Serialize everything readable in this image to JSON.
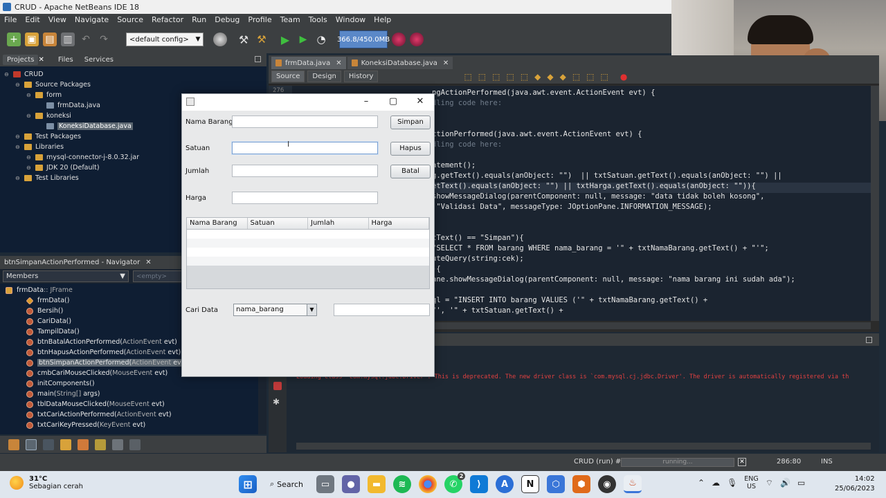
{
  "window": {
    "title": "CRUD - Apache NetBeans IDE 18"
  },
  "menubar": [
    "File",
    "Edit",
    "View",
    "Navigate",
    "Source",
    "Refactor",
    "Run",
    "Debug",
    "Profile",
    "Team",
    "Tools",
    "Window",
    "Help"
  ],
  "toolbar": {
    "config": "<default config>",
    "memory": "366.8/450.0MB"
  },
  "projects_panel": {
    "tabs": [
      "Projects",
      "Files",
      "Services"
    ],
    "tree": [
      {
        "label": "CRUD",
        "level": 0
      },
      {
        "label": "Source Packages",
        "level": 1
      },
      {
        "label": "form",
        "level": 2
      },
      {
        "label": "frmData.java",
        "level": 3
      },
      {
        "label": "koneksi",
        "level": 2
      },
      {
        "label": "KoneksiDatabase.java",
        "level": 3,
        "selected": true
      },
      {
        "label": "Test Packages",
        "level": 1
      },
      {
        "label": "Libraries",
        "level": 1
      },
      {
        "label": "mysql-connector-j-8.0.32.jar",
        "level": 2
      },
      {
        "label": "JDK 20 (Default)",
        "level": 2
      },
      {
        "label": "Test Libraries",
        "level": 1
      }
    ]
  },
  "navigator": {
    "title": "btnSimpanActionPerformed - Navigator",
    "members_label": "Members",
    "empty_label": "<empty>",
    "root": {
      "name": "frmData",
      "type": " :: JFrame"
    },
    "items": [
      {
        "name": "frmData()",
        "params": "",
        "kind": "ctor"
      },
      {
        "name": "Bersih()",
        "params": "",
        "kind": "method"
      },
      {
        "name": "CariData()",
        "params": "",
        "kind": "method"
      },
      {
        "name": "TampilData()",
        "params": "",
        "kind": "method"
      },
      {
        "name": "btnBatalActionPerformed(",
        "params": "ActionEvent",
        "tail": " evt)",
        "kind": "method"
      },
      {
        "name": "btnHapusActionPerformed(",
        "params": "ActionEvent",
        "tail": " evt)",
        "kind": "method"
      },
      {
        "name": "btnSimpanActionPerformed(",
        "params": "ActionEvent",
        "tail": " evt)",
        "kind": "method",
        "selected": true
      },
      {
        "name": "cmbCariMouseClicked(",
        "params": "MouseEvent",
        "tail": " evt)",
        "kind": "method"
      },
      {
        "name": "initComponents()",
        "params": "",
        "kind": "method"
      },
      {
        "name": "main(",
        "params": "String[]",
        "tail": " args)",
        "kind": "method"
      },
      {
        "name": "tblDataMouseClicked(",
        "params": "MouseEvent",
        "tail": " evt)",
        "kind": "method"
      },
      {
        "name": "txtCariActionPerformed(",
        "params": "ActionEvent",
        "tail": " evt)",
        "kind": "method"
      },
      {
        "name": "txtCariKeyPressed(",
        "params": "KeyEvent",
        "tail": " evt)",
        "kind": "method"
      }
    ]
  },
  "editor": {
    "tabs": [
      {
        "label": "frmData.java",
        "active": true
      },
      {
        "label": "KoneksiDatabase.java",
        "active": false
      }
    ],
    "subtabs": [
      "Source",
      "Design",
      "History"
    ],
    "line_number": "276",
    "code_lines": [
      "ngActionPerformed(java.awt.event.ActionEvent evt) {",
      "dling code here:",
      "",
      "",
      "ctionPerformed(java.awt.event.ActionEvent evt) {",
      "dling code here:",
      "",
      "atement();",
      "g.getText().equals(anObject: \"\")  || txtSatuan.getText().equals(anObject: \"\") ||",
      "etText().equals(anObject: \"\") || txtHarga.getText().equals(anObject: \"\")){",
      "showMessageDialog(parentComponent: null, message: \"data tidak boleh kosong\",",
      " \"Validasi Data\", messageType: JOptionPane.INFORMATION_MESSAGE);",
      "",
      "",
      "tText() == \"Simpan\"){",
      "\"SELECT * FROM barang WHERE nama_barang = '\" + txtNamaBarang.getText() + \"'\";",
      "uteQuery(string:cek);",
      "){",
      "ane.showMessageDialog(parentComponent: null, message: \"nama barang ini sudah ada\");",
      "",
      "ql = \"INSERT INTO barang VALUES ('\" + txtNamaBarang.getText() +",
      "\"', '\" + txtSatuan.getText() +"
    ]
  },
  "output": {
    "text": "Loading class `com.mysql.jdbc.Driver'. This is deprecated. The new driver class is `com.mysql.cj.jdbc.Driver'. The driver is automatically registered via th"
  },
  "statusbar": {
    "run": "CRUD (run) #2",
    "progress": "running...",
    "position": "286:80",
    "mode": "INS"
  },
  "dialog": {
    "labels": {
      "nama_barang": "Nama Barang",
      "satuan": "Satuan",
      "jumlah": "Jumlah",
      "harga": "Harga",
      "cari": "Cari Data"
    },
    "buttons": {
      "simpan": "Simpan",
      "hapus": "Hapus",
      "batal": "Batal"
    },
    "table_headers": [
      "Nama Barang",
      "Satuan",
      "Jumlah",
      "Harga"
    ],
    "cari_select": "nama_barang"
  },
  "taskbar": {
    "weather": {
      "temp": "31°C",
      "desc": "Sebagian cerah"
    },
    "search": "Search",
    "lang": [
      "ENG",
      "US"
    ],
    "time": "14:02",
    "date": "25/06/2023",
    "whatsapp_badge": "2"
  }
}
